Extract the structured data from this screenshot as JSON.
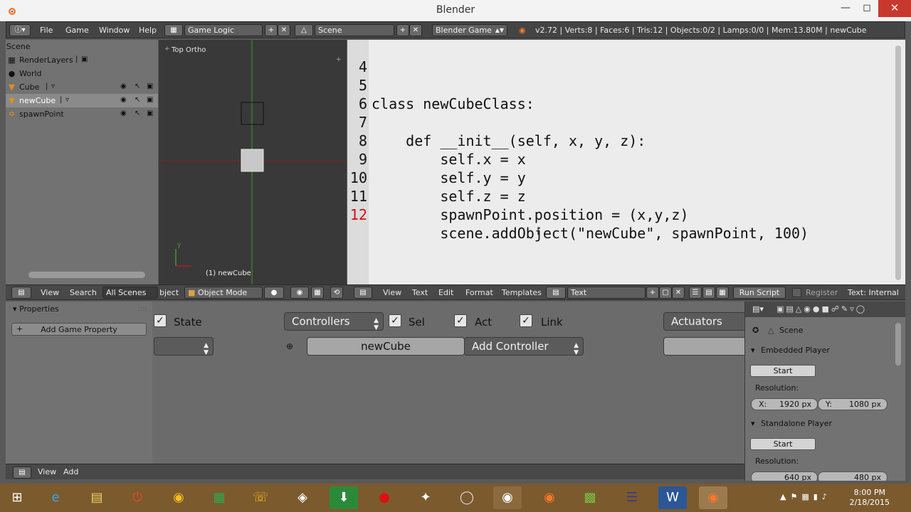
{
  "window": {
    "title": "Blender"
  },
  "infobar": {
    "menus": [
      "File",
      "Game",
      "Window",
      "Help"
    ],
    "screen_layout": "Game Logic",
    "scene": "Scene",
    "engine": "Blender Game",
    "stats": "v2.72 | Verts:8 | Faces:6 | Tris:12 | Objects:0/2 | Lamps:0/0 | Mem:13.80M | newCube"
  },
  "outliner": {
    "root": "Scene",
    "items": [
      "RenderLayers",
      "World",
      "Cube",
      "newCube",
      "spawnPoint"
    ]
  },
  "viewport": {
    "view_label": "Top Ortho",
    "object_label": "(1) newCube",
    "axis_y": "y"
  },
  "text_editor": {
    "lines": [
      {
        "n": "4",
        "text": ""
      },
      {
        "n": "5",
        "text": "class newCubeClass:"
      },
      {
        "n": "6",
        "text": ""
      },
      {
        "n": "7",
        "text": "    def __init__(self, x, y, z):"
      },
      {
        "n": "8",
        "text": "        self.x = x"
      },
      {
        "n": "9",
        "text": "        self.y = y"
      },
      {
        "n": "10",
        "text": "        self.z = z"
      },
      {
        "n": "11",
        "text": "        spawnPoint.position = (x,y,z)"
      },
      {
        "n": "12",
        "text": "        scene.addObject(\"newCube\", spawnPoint, 100)"
      }
    ]
  },
  "mid_header": {
    "outliner_view": "View",
    "outliner_search": "Search",
    "outliner_filter": "All Scenes",
    "viewport_partial": "bject",
    "mode": "Object Mode",
    "text_menus": [
      "View",
      "Text",
      "Edit",
      "Format",
      "Templates"
    ],
    "text_block": "Text",
    "run_script": "Run Script",
    "register": "Register",
    "text_status": "Text: Internal"
  },
  "logic": {
    "properties_title": "Properties",
    "add_property": "Add Game Property",
    "state": "State",
    "controllers": "Controllers",
    "sel": "Sel",
    "act": "Act",
    "link": "Link",
    "actuators": "Actuators",
    "object_name": "newCube",
    "add_controller": "Add Controller",
    "footer_view": "View",
    "footer_add": "Add"
  },
  "properties": {
    "context": "Scene",
    "embedded_title": "Embedded Player",
    "embedded_start": "Start",
    "resolution_label": "Resolution:",
    "emb_x_label": "X:",
    "emb_x": "1920 px",
    "emb_y_label": "Y:",
    "emb_y": "1080 px",
    "standalone_title": "Standalone Player",
    "standalone_start": "Start",
    "standalone_resolution_label": "Resolution:",
    "sa_x": "640 px",
    "sa_y": "480 px"
  },
  "taskbar": {
    "time": "8:00 PM",
    "date": "2/18/2015"
  }
}
